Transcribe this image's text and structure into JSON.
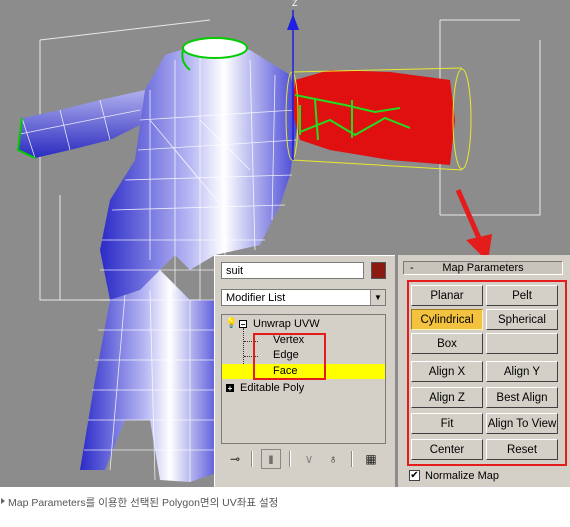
{
  "viewport": {
    "axis_label": "Z"
  },
  "modifier_panel": {
    "object_name": "suit",
    "object_color": "#8b1a12",
    "modifier_list_label": "Modifier List",
    "stack": {
      "modifier": "Unwrap UVW",
      "sub_objects": [
        "Vertex",
        "Edge",
        "Face"
      ],
      "selected_sub_object": "Face",
      "base_object": "Editable Poly"
    },
    "toolbar_icons": [
      "pin-stack-icon",
      "show-end-result-icon",
      "make-unique-icon",
      "remove-modifier-icon",
      "configure-modifier-sets-icon"
    ]
  },
  "map_parameters": {
    "title": "Map Parameters",
    "collapse_symbol": "-",
    "buttons": [
      "Planar",
      "Pelt",
      "Cylindrical",
      "Spherical",
      "Box",
      "",
      "Align X",
      "Align Y",
      "Align Z",
      "Best Align",
      "Fit",
      "Align To View",
      "Center",
      "Reset"
    ],
    "active_button": "Cylindrical",
    "normalize_map_label": "Normalize Map",
    "normalize_map_checked": true
  },
  "caption": {
    "text": "Map Parameters를 이용한 선택된 Polygon면의 UV좌표 설정"
  },
  "colors": {
    "accent_active": "#f3c23f",
    "highlight_box": "#e51c1c",
    "selection_yellow": "#ffff00",
    "panel_bg": "#d4d0c8",
    "viewport_bg": "#8c8c8c",
    "mesh_blue": "#4a4ad8",
    "selected_poly_red": "#e01010"
  }
}
